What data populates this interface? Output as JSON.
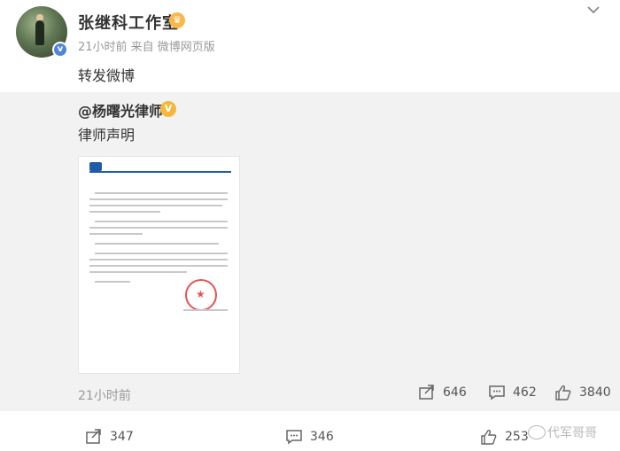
{
  "post": {
    "username": "张继科工作室",
    "meta": "21小时前  来自 微博网页版",
    "text": "转发微博"
  },
  "repost": {
    "username": "@杨曙光律师",
    "text": "律师声明",
    "time": "21小时前",
    "share_count": "646",
    "comment_count": "462",
    "like_count": "3840"
  },
  "footer": {
    "share_count": "347",
    "comment_count": "346",
    "like_count": "253"
  },
  "watermark": "代军哥哥",
  "icons": {
    "verify": "blue-v-badge-icon",
    "crown": "member-crown-icon",
    "gold_v": "gold-v-badge-icon",
    "menu": "chevron-down-icon",
    "share": "share-icon",
    "comment": "comment-icon",
    "like": "thumbs-up-icon"
  },
  "colors": {
    "repost_bg": "#f2f2f2",
    "verify_blue": "#4e86d9",
    "gold": "#f6b73c",
    "meta_gray": "#999999"
  }
}
